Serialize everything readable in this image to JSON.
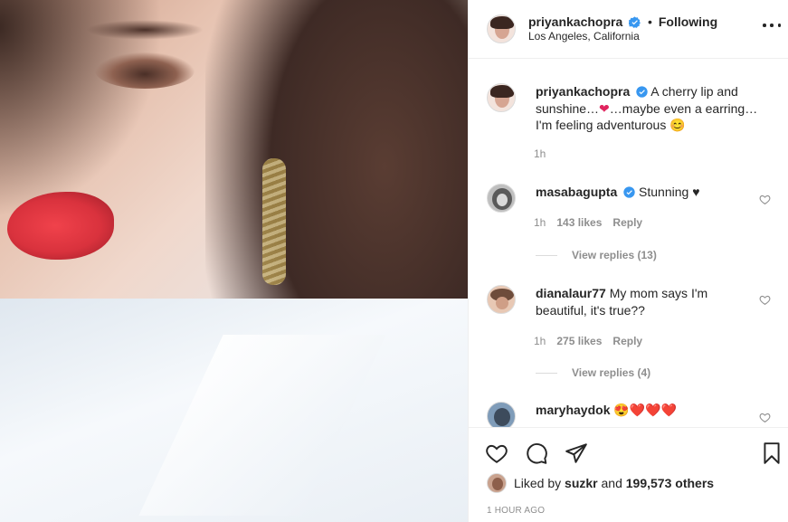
{
  "post": {
    "image_alt": "Close-up portrait with red lipstick and gold earring in sunlight",
    "header": {
      "username": "priyankachopra",
      "separator": "•",
      "follow_state": "Following",
      "location": "Los Angeles, California",
      "more_icon": "more-options-icon"
    },
    "caption": {
      "username": "priyankachopra",
      "text_part1": "A cherry lip and sunshine…",
      "text_part2": "…maybe even a earring…I'm feeling adventurous",
      "emoji_heart": "❤",
      "emoji_smile": "😊",
      "time": "1h"
    },
    "comments": [
      {
        "username": "masabagupta",
        "verified": true,
        "text": "Stunning ♥",
        "time": "1h",
        "likes": "143 likes",
        "reply": "Reply",
        "view_replies": "View replies (13)"
      },
      {
        "username": "dianalaur77",
        "verified": false,
        "text": "My mom says I'm beautiful, it's true??",
        "time": "1h",
        "likes": "275 likes",
        "reply": "Reply",
        "view_replies": "View replies (4)"
      },
      {
        "username": "maryhaydok",
        "verified": false,
        "text": "😍❤️❤️❤️"
      }
    ],
    "likes": {
      "prefix": "Liked by",
      "user": "suzkr",
      "middle": "and",
      "others": "199,573 others"
    },
    "timestamp": "1 HOUR AGO",
    "colors": {
      "text": "#262626",
      "muted": "#8e8e8e",
      "verified": "#3897f0",
      "border": "#efefef"
    }
  }
}
